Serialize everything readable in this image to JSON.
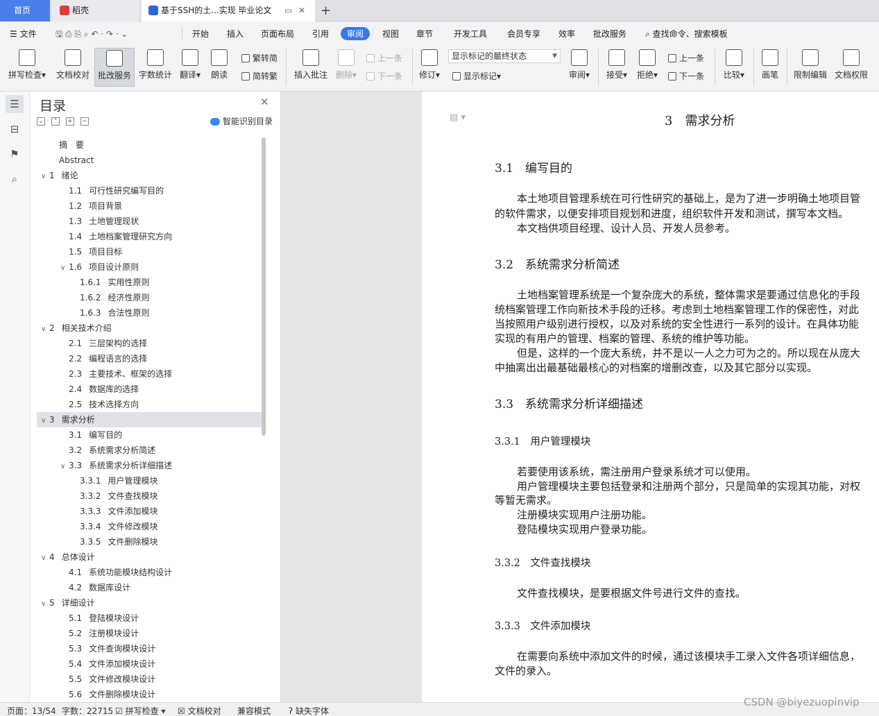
{
  "tabs": {
    "home": "首页",
    "daoke": "稻壳",
    "doc": "基于SSH的土...实现 毕业论文"
  },
  "menu": {
    "file": "文件",
    "items": [
      "开始",
      "插入",
      "页面布局",
      "引用",
      "审阅",
      "视图",
      "章节",
      "开发工具",
      "会员专享",
      "效率",
      "批改服务"
    ],
    "active": "审阅",
    "search": "查找命令、搜索模板"
  },
  "ribbon": {
    "spell": "拼写检查",
    "proof": "文档校对",
    "review_service": "批改服务",
    "wordcount": "字数统计",
    "translate": "翻译",
    "read": "朗读",
    "to_trad": "繁转简",
    "to_simp": "简转繁",
    "insert_comment": "插入批注",
    "delete": "删除",
    "prev": "上一条",
    "next": "下一条",
    "revise": "修订",
    "markup_state": "显示标记的最终状态",
    "show_markup": "显示标记",
    "review": "审阅",
    "accept": "接受",
    "reject": "拒绝",
    "prev2": "上一条",
    "next2": "下一条",
    "compare": "比较",
    "pen": "画笔",
    "restrict": "限制编辑",
    "permission": "文档权限"
  },
  "toc": {
    "title": "目录",
    "smart": "智能识别目录",
    "items": [
      {
        "num": "",
        "text": "摘　要",
        "level": 0
      },
      {
        "num": "",
        "text": "Abstract",
        "level": 0
      },
      {
        "num": "1",
        "text": "绪论",
        "level": 1,
        "tw": "∨"
      },
      {
        "num": "1.1",
        "text": "可行性研究编写目的",
        "level": 2
      },
      {
        "num": "1.2",
        "text": "项目背景",
        "level": 2
      },
      {
        "num": "1.3",
        "text": "土地管理现状",
        "level": 2
      },
      {
        "num": "1.4",
        "text": "土地档案管理研究方向",
        "level": 2
      },
      {
        "num": "1.5",
        "text": "项目目标",
        "level": 2
      },
      {
        "num": "1.6",
        "text": "项目设计原则",
        "level": 2,
        "tw": "∨"
      },
      {
        "num": "1.6.1",
        "text": "实用性原则",
        "level": 3
      },
      {
        "num": "1.6.2",
        "text": "经济性原则",
        "level": 3
      },
      {
        "num": "1.6.3",
        "text": "合法性原则",
        "level": 3
      },
      {
        "num": "2",
        "text": "相关技术介绍",
        "level": 1,
        "tw": "∨"
      },
      {
        "num": "2.1",
        "text": "三层架构的选择",
        "level": 2
      },
      {
        "num": "2.2",
        "text": "编程语言的选择",
        "level": 2
      },
      {
        "num": "2.3",
        "text": "主要技术、框架的选择",
        "level": 2
      },
      {
        "num": "2.4",
        "text": "数据库的选择",
        "level": 2
      },
      {
        "num": "2.5",
        "text": "技术选择方向",
        "level": 2
      },
      {
        "num": "3",
        "text": "需求分析",
        "level": 1,
        "tw": "∨",
        "hl": true
      },
      {
        "num": "3.1",
        "text": "编写目的",
        "level": 2
      },
      {
        "num": "3.2",
        "text": "系统需求分析简述",
        "level": 2
      },
      {
        "num": "3.3",
        "text": "系统需求分析详细描述",
        "level": 2,
        "tw": "∨"
      },
      {
        "num": "3.3.1",
        "text": "用户管理模块",
        "level": 3
      },
      {
        "num": "3.3.2",
        "text": "文件查找模块",
        "level": 3
      },
      {
        "num": "3.3.3",
        "text": "文件添加模块",
        "level": 3
      },
      {
        "num": "3.3.4",
        "text": "文件修改模块",
        "level": 3
      },
      {
        "num": "3.3.5",
        "text": "文件删除模块",
        "level": 3
      },
      {
        "num": "4",
        "text": "总体设计",
        "level": 1,
        "tw": "∨"
      },
      {
        "num": "4.1",
        "text": "系统功能模块结构设计",
        "level": 2
      },
      {
        "num": "4.2",
        "text": "数据库设计",
        "level": 2
      },
      {
        "num": "5",
        "text": "详细设计",
        "level": 1,
        "tw": "∨"
      },
      {
        "num": "5.1",
        "text": "登陆模块设计",
        "level": 2
      },
      {
        "num": "5.2",
        "text": "注册模块设计",
        "level": 2
      },
      {
        "num": "5.3",
        "text": "文件查询模块设计",
        "level": 2
      },
      {
        "num": "5.4",
        "text": "文件添加模块设计",
        "level": 2
      },
      {
        "num": "5.5",
        "text": "文件修改模块设计",
        "level": 2
      },
      {
        "num": "5.6",
        "text": "文件删除模块设计",
        "level": 2
      }
    ]
  },
  "doc": {
    "h_chapter": "3　需求分析",
    "h_31": "3.1　编写目的",
    "p_31a": "本土地项目管理系统在可行性研究的基础上，是为了进一步明确土地项目管",
    "p_31b": "的软件需求，以便安排项目规划和进度，组织软件开发和测试，撰写本文档。",
    "p_31c": "本文档供项目经理、设计人员、开发人员参考。",
    "h_32": "3.2　系统需求分析简述",
    "p_32a": "土地档案管理系统是一个复杂庞大的系统，整体需求是要通过信息化的手段",
    "p_32b": "统档案管理工作向新技术手段的迁移。考虑到土地档案管理工作的保密性，对此",
    "p_32c": "当按照用户级别进行授权，以及对系统的安全性进行一系列的设计。在具体功能",
    "p_32d": "实现的有用户的管理、档案的管理、系统的维护等功能。",
    "p_32e": "但是，这样的一个庞大系统，并不是以一人之力可为之的。所以现在从庞大",
    "p_32f": "中抽离出出最基础最核心的对档案的增删改查，以及其它部分以实现。",
    "h_33": "3.3　系统需求分析详细描述",
    "h_331": "3.3.1　用户管理模块",
    "p_331a": "若要使用该系统，需注册用户登录系统才可以使用。",
    "p_331b": "用户管理模块主要包括登录和注册两个部分，只是简单的实现其功能，对权",
    "p_331c": "等暂无需求。",
    "p_331d": "注册模块实现用户注册功能。",
    "p_331e": "登陆模块实现用户登录功能。",
    "h_332": "3.3.2　文件查找模块",
    "p_332a": "文件查找模块，是要根据文件号进行文件的查找。",
    "h_333": "3.3.3　文件添加模块",
    "p_333a": "在需要向系统中添加文件的时候，通过该模块手工录入文件各项详细信息，",
    "p_333b": "文件的录入。"
  },
  "status": {
    "page": "页面：13/54",
    "words": "字数：22715",
    "spell": "拼写检查",
    "proof": "文档校对",
    "compat": "兼容模式",
    "missing_font": "缺失字体"
  },
  "watermark": "CSDN @biyezuopinvip"
}
